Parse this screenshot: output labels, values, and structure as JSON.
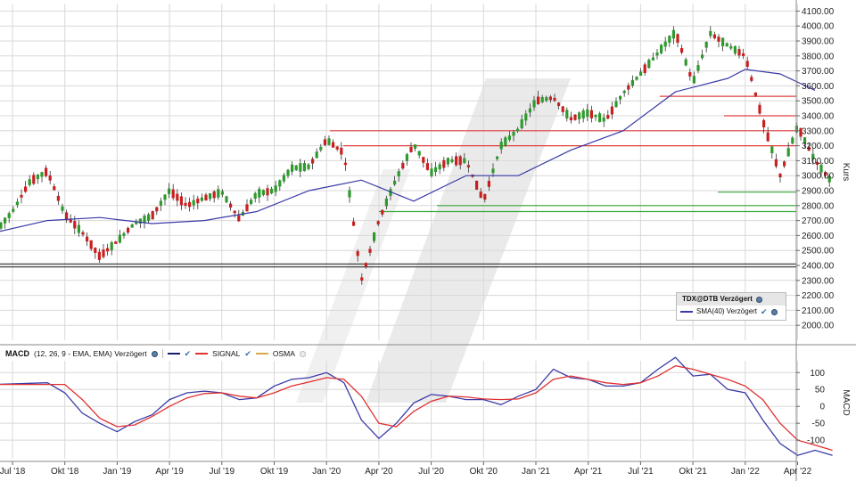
{
  "chart_data": [
    {
      "type": "candlestick",
      "ylabel": "Kurs",
      "ylim": [
        1900,
        4150
      ],
      "yticks": [
        "4100.00",
        "4000.00",
        "3900.00",
        "3800.00",
        "3700.00",
        "3600.00",
        "3500.00",
        "3400.00",
        "3300.00",
        "3200.00",
        "3100.00",
        "3000.00",
        "2900.00",
        "2800.00",
        "2700.00",
        "2600.00",
        "2500.00",
        "2400.00",
        "2300.00",
        "2200.00",
        "2100.00",
        "2000.00"
      ],
      "xticks": [
        "Jul '18",
        "Okt '18",
        "Jan '19",
        "Apr '19",
        "Jul '19",
        "Okt '19",
        "Jan '20",
        "Apr '20",
        "Jul '20",
        "Okt '20",
        "Jan '21",
        "Apr '21",
        "Jul '21",
        "Okt '21",
        "Jan '22",
        "Apr '22"
      ],
      "price_series": [
        [
          "2018-06",
          2620
        ],
        [
          "2018-07",
          2760
        ],
        [
          "2018-08",
          2960
        ],
        [
          "2018-09",
          3030
        ],
        [
          "2018-10",
          2740
        ],
        [
          "2018-11",
          2620
        ],
        [
          "2018-12",
          2460
        ],
        [
          "2019-01",
          2560
        ],
        [
          "2019-02",
          2680
        ],
        [
          "2019-03",
          2730
        ],
        [
          "2019-04",
          2900
        ],
        [
          "2019-05",
          2800
        ],
        [
          "2019-06",
          2850
        ],
        [
          "2019-07",
          2890
        ],
        [
          "2019-08",
          2710
        ],
        [
          "2019-09",
          2880
        ],
        [
          "2019-10",
          2900
        ],
        [
          "2019-11",
          3050
        ],
        [
          "2019-12",
          3060
        ],
        [
          "2020-01",
          3240
        ],
        [
          "2020-02",
          3150
        ],
        [
          "2020-03",
          2300
        ],
        [
          "2020-04",
          2700
        ],
        [
          "2020-05",
          2980
        ],
        [
          "2020-06",
          3210
        ],
        [
          "2020-07",
          3020
        ],
        [
          "2020-08",
          3100
        ],
        [
          "2020-09",
          3100
        ],
        [
          "2020-10",
          2830
        ],
        [
          "2020-11",
          3200
        ],
        [
          "2020-12",
          3310
        ],
        [
          "2021-01",
          3500
        ],
        [
          "2021-02",
          3520
        ],
        [
          "2021-03",
          3380
        ],
        [
          "2021-04",
          3420
        ],
        [
          "2021-05",
          3370
        ],
        [
          "2021-06",
          3550
        ],
        [
          "2021-07",
          3680
        ],
        [
          "2021-08",
          3820
        ],
        [
          "2021-09",
          3960
        ],
        [
          "2021-10",
          3620
        ],
        [
          "2021-11",
          3950
        ],
        [
          "2021-12",
          3870
        ],
        [
          "2022-01",
          3800
        ],
        [
          "2022-02",
          3370
        ],
        [
          "2022-03",
          3000
        ],
        [
          "2022-04",
          3330
        ],
        [
          "2022-05",
          3100
        ],
        [
          "2022-06",
          2950
        ]
      ],
      "series": [
        {
          "name": "SMA(40) Verzögert",
          "color": "#3a3aa8",
          "values": [
            [
              "2018-06",
              2620
            ],
            [
              "2018-09",
              2700
            ],
            [
              "2018-12",
              2720
            ],
            [
              "2019-03",
              2680
            ],
            [
              "2019-06",
              2700
            ],
            [
              "2019-09",
              2760
            ],
            [
              "2019-12",
              2900
            ],
            [
              "2020-03",
              2970
            ],
            [
              "2020-06",
              2830
            ],
            [
              "2020-09",
              3000
            ],
            [
              "2020-12",
              3000
            ],
            [
              "2021-03",
              3170
            ],
            [
              "2021-06",
              3300
            ],
            [
              "2021-09",
              3560
            ],
            [
              "2021-12",
              3650
            ],
            [
              "2022-01",
              3710
            ],
            [
              "2022-03",
              3680
            ],
            [
              "2022-05",
              3570
            ]
          ]
        }
      ],
      "hlines_red": [
        3530,
        3400,
        3300,
        3200
      ],
      "hlines_green": [
        2890,
        2800,
        2760
      ],
      "hlines_black": [
        2410,
        2390
      ],
      "legend": {
        "title": "TDX@DTB Verzögert",
        "sma_label": "SMA(40) Verzögert"
      }
    },
    {
      "type": "line",
      "ylabel": "MACD",
      "ylim": [
        -155,
        135
      ],
      "yticks": [
        "100",
        "50",
        "0",
        "-50",
        "-100"
      ],
      "header": {
        "title": "MACD",
        "params": "(12, 26, 9 - EMA, EMA) Verzögert",
        "signal_label": "SIGNAL",
        "osma_label": "OSMA"
      },
      "series": [
        {
          "name": "MACD",
          "color": "#3a3aa8",
          "values": [
            [
              "2018-06",
              65
            ],
            [
              "2018-09",
              70
            ],
            [
              "2018-10",
              40
            ],
            [
              "2018-11",
              -20
            ],
            [
              "2018-12",
              -50
            ],
            [
              "2019-01",
              -75
            ],
            [
              "2019-02",
              -45
            ],
            [
              "2019-03",
              -25
            ],
            [
              "2019-04",
              20
            ],
            [
              "2019-05",
              40
            ],
            [
              "2019-06",
              45
            ],
            [
              "2019-07",
              40
            ],
            [
              "2019-08",
              20
            ],
            [
              "2019-09",
              25
            ],
            [
              "2019-10",
              60
            ],
            [
              "2019-11",
              80
            ],
            [
              "2019-12",
              85
            ],
            [
              "2020-01",
              100
            ],
            [
              "2020-02",
              70
            ],
            [
              "2020-03",
              -40
            ],
            [
              "2020-04",
              -95
            ],
            [
              "2020-05",
              -50
            ],
            [
              "2020-06",
              10
            ],
            [
              "2020-07",
              35
            ],
            [
              "2020-08",
              30
            ],
            [
              "2020-09",
              20
            ],
            [
              "2020-10",
              20
            ],
            [
              "2020-11",
              5
            ],
            [
              "2020-12",
              30
            ],
            [
              "2021-01",
              50
            ],
            [
              "2021-02",
              110
            ],
            [
              "2021-03",
              85
            ],
            [
              "2021-04",
              80
            ],
            [
              "2021-05",
              60
            ],
            [
              "2021-06",
              60
            ],
            [
              "2021-07",
              70
            ],
            [
              "2021-08",
              110
            ],
            [
              "2021-09",
              145
            ],
            [
              "2021-10",
              90
            ],
            [
              "2021-11",
              95
            ],
            [
              "2021-12",
              50
            ],
            [
              "2022-01",
              40
            ],
            [
              "2022-02",
              -40
            ],
            [
              "2022-03",
              -110
            ],
            [
              "2022-04",
              -145
            ],
            [
              "2022-05",
              -130
            ],
            [
              "2022-06",
              -145
            ]
          ]
        },
        {
          "name": "SIGNAL",
          "color": "#e03030",
          "values": [
            [
              "2018-06",
              65
            ],
            [
              "2018-09",
              65
            ],
            [
              "2018-10",
              65
            ],
            [
              "2018-11",
              20
            ],
            [
              "2018-12",
              -35
            ],
            [
              "2019-01",
              -60
            ],
            [
              "2019-02",
              -55
            ],
            [
              "2019-03",
              -30
            ],
            [
              "2019-04",
              0
            ],
            [
              "2019-05",
              25
            ],
            [
              "2019-06",
              38
            ],
            [
              "2019-07",
              40
            ],
            [
              "2019-08",
              30
            ],
            [
              "2019-09",
              25
            ],
            [
              "2019-10",
              40
            ],
            [
              "2019-11",
              60
            ],
            [
              "2019-12",
              72
            ],
            [
              "2020-01",
              85
            ],
            [
              "2020-02",
              80
            ],
            [
              "2020-03",
              30
            ],
            [
              "2020-04",
              -50
            ],
            [
              "2020-05",
              -60
            ],
            [
              "2020-06",
              -15
            ],
            [
              "2020-07",
              15
            ],
            [
              "2020-08",
              30
            ],
            [
              "2020-09",
              28
            ],
            [
              "2020-10",
              22
            ],
            [
              "2020-11",
              20
            ],
            [
              "2020-12",
              22
            ],
            [
              "2021-01",
              40
            ],
            [
              "2021-02",
              80
            ],
            [
              "2021-03",
              90
            ],
            [
              "2021-04",
              80
            ],
            [
              "2021-05",
              70
            ],
            [
              "2021-06",
              65
            ],
            [
              "2021-07",
              70
            ],
            [
              "2021-08",
              90
            ],
            [
              "2021-09",
              120
            ],
            [
              "2021-10",
              110
            ],
            [
              "2021-11",
              95
            ],
            [
              "2021-12",
              80
            ],
            [
              "2022-01",
              60
            ],
            [
              "2022-02",
              20
            ],
            [
              "2022-03",
              -50
            ],
            [
              "2022-04",
              -100
            ],
            [
              "2022-05",
              -115
            ],
            [
              "2022-06",
              -130
            ]
          ]
        }
      ]
    }
  ]
}
